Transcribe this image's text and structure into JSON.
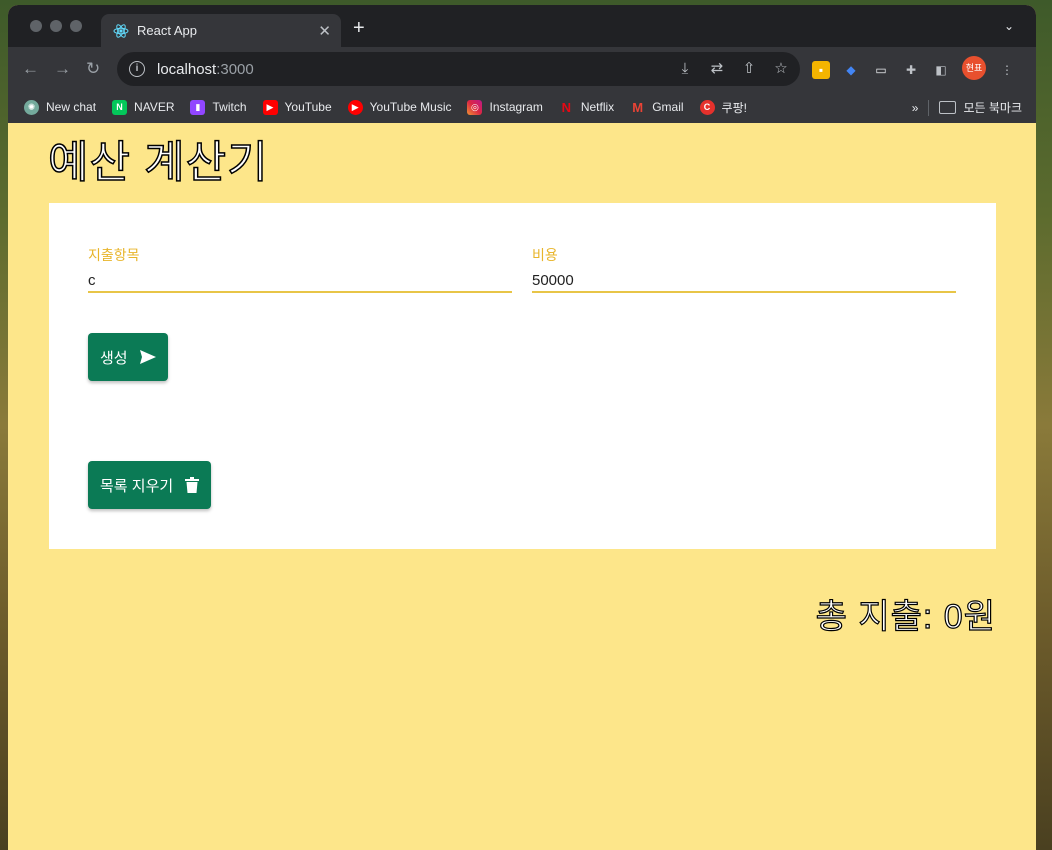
{
  "browser": {
    "tab_title": "React App",
    "url_host": "localhost",
    "url_port": ":3000",
    "profile_label": "현표",
    "bookmarks": [
      {
        "label": "New chat",
        "icon": "chatgpt-icon",
        "color": "#74aa9c"
      },
      {
        "label": "NAVER",
        "icon": "naver-icon",
        "color": "#03c75a"
      },
      {
        "label": "Twitch",
        "icon": "twitch-icon",
        "color": "#9146ff"
      },
      {
        "label": "YouTube",
        "icon": "youtube-icon",
        "color": "#ff0000"
      },
      {
        "label": "YouTube Music",
        "icon": "youtube-music-icon",
        "color": "#ff0000"
      },
      {
        "label": "Instagram",
        "icon": "instagram-icon",
        "color": "#d6249f"
      },
      {
        "label": "Netflix",
        "icon": "netflix-icon",
        "color": "#e50914"
      },
      {
        "label": "Gmail",
        "icon": "gmail-icon",
        "color": "#ea4335"
      },
      {
        "label": "쿠팡!",
        "icon": "coupang-icon",
        "color": "#e5312c"
      }
    ],
    "all_bookmarks_label": "모든 북마크"
  },
  "app": {
    "title": "예산 계산기",
    "form": {
      "item_label": "지출항목",
      "item_value": "c",
      "cost_label": "비용",
      "cost_value": "50000"
    },
    "submit_label": "생성",
    "clear_label": "목록 지우기",
    "total_text": "총 지출: 0원",
    "colors": {
      "background": "#fde68a",
      "button": "#0b7a55",
      "label": "#e8b52b"
    }
  }
}
